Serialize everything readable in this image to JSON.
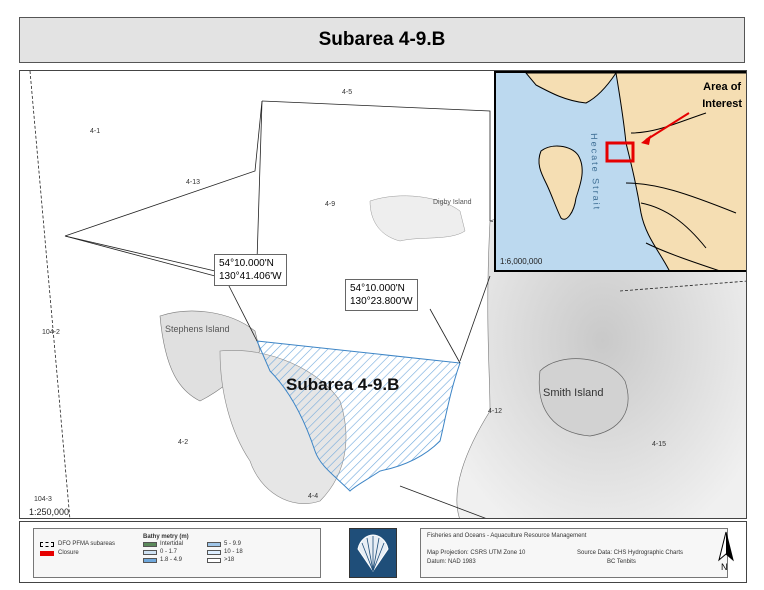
{
  "title": "Subarea 4-9.B",
  "map": {
    "area_labels": [
      "4-5",
      "4-1",
      "4-13",
      "4-9",
      "104-2",
      "4-2",
      "4-12",
      "4-15",
      "4-4",
      "104-3"
    ],
    "islands": {
      "digby": "Digby Island",
      "stephens": "Stephens Island",
      "smith": "Smith Island"
    },
    "coord1": {
      "lat": "54°10.000'N",
      "lon": "130°41.406'W"
    },
    "coord2": {
      "lat": "54°10.000'N",
      "lon": "130°23.800'W"
    },
    "subarea_label": "Subarea 4-9.B",
    "scale": "1:250,000",
    "colors": {
      "closure_hatch": "#6fa8dc",
      "land": "#f5deb3",
      "water": "#bcd9ef",
      "closure": "#e60000"
    }
  },
  "inset": {
    "aoi_line1": "Area of",
    "aoi_line2": "Interest",
    "strait": "Hecate Strait",
    "scale": "1:6,000,000"
  },
  "legend": {
    "pfma": "DFO PFMA subareas",
    "closure": "Closure",
    "bathy_title": "Bathy metry (m)",
    "bathy_items": [
      "Intertidal",
      "0 - 1.7",
      "1.8 - 4.9",
      "5 - 9.9",
      "10 - 18",
      ">18"
    ],
    "org": "Fisheries and Oceans - Aquaculture Resource Management",
    "projection": "Map Projection: CSRS UTM Zone 10",
    "datum": "Datum: NAD 1983",
    "source": "Source Data: CHS Hydrographic Charts",
    "source2": "BC Tenbits",
    "north": "N"
  }
}
